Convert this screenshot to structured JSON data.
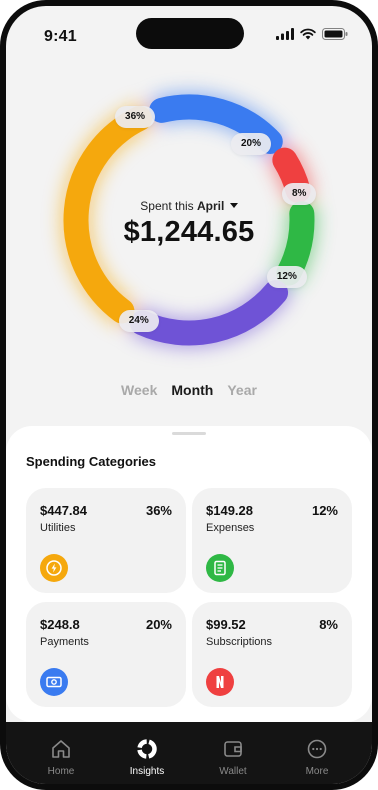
{
  "status_bar": {
    "time": "9:41"
  },
  "summary": {
    "spent_prefix": "Spent this",
    "month": "April",
    "amount": "$1,244.65"
  },
  "donut": {
    "segments": [
      {
        "name": "Payments",
        "percent": 20,
        "label": "20%",
        "color": "#3a7bf0"
      },
      {
        "name": "Subscriptions",
        "percent": 8,
        "label": "8%",
        "color": "#ef4040"
      },
      {
        "name": "Expenses",
        "percent": 12,
        "label": "12%",
        "color": "#2fb845"
      },
      {
        "name": "Unlabeled purple",
        "percent": 24,
        "label": "24%",
        "color": "#6f53d6"
      },
      {
        "name": "Utilities",
        "percent": 36,
        "label": "36%",
        "color": "#f5a80d"
      }
    ]
  },
  "periods": {
    "week": "Week",
    "month": "Month",
    "year": "Year",
    "active": "month"
  },
  "categories": {
    "title": "Spending Categories",
    "items": [
      {
        "amount": "$447.84",
        "percent": "36%",
        "label": "Utilities",
        "icon": "bolt-icon",
        "color": "#f5a80d"
      },
      {
        "amount": "$149.28",
        "percent": "12%",
        "label": "Expenses",
        "icon": "receipt-icon",
        "color": "#2fb845"
      },
      {
        "amount": "$248.8",
        "percent": "20%",
        "label": "Payments",
        "icon": "cash-icon",
        "color": "#3a7bf0"
      },
      {
        "amount": "$99.52",
        "percent": "8%",
        "label": "Subscriptions",
        "icon": "netflix-icon",
        "color": "#ef4040"
      }
    ]
  },
  "tabbar": {
    "home": "Home",
    "insights": "Insights",
    "wallet": "Wallet",
    "more": "More",
    "active": "insights"
  }
}
